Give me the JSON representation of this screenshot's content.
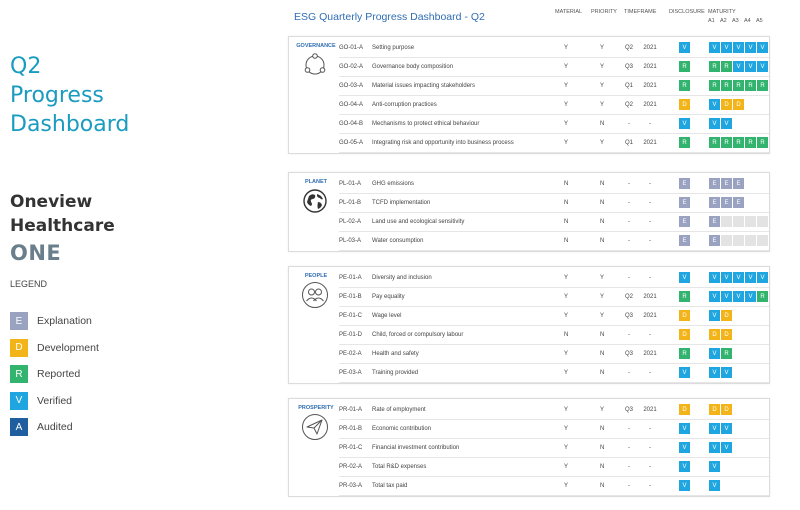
{
  "left": {
    "title_lines": [
      "Q2",
      "Progress",
      "Dashboard"
    ],
    "company_lines": [
      "Oneview",
      "Healthcare"
    ],
    "ticker": "ONE",
    "legend_title": "LEGEND",
    "legend": [
      {
        "letter": "E",
        "label": "Explanation",
        "color": "#9aa2c2"
      },
      {
        "letter": "D",
        "label": "Development",
        "color": "#f2b418"
      },
      {
        "letter": "R",
        "label": "Reported",
        "color": "#33b46e"
      },
      {
        "letter": "V",
        "label": "Verified",
        "color": "#1fa6e0"
      },
      {
        "letter": "A",
        "label": "Audited",
        "color": "#1f5f9f"
      }
    ]
  },
  "dashboard": {
    "title": "ESG Quarterly Progress Dashboard - Q2",
    "headers": {
      "material": "MATERIAL",
      "priority": "PRIORITY",
      "timeframe": "TIMEFRAME",
      "disclosure": "DISCLOSURE",
      "maturity": "MATURITY",
      "maturity_levels": [
        "A1",
        "A2",
        "A3",
        "A4",
        "A5"
      ]
    },
    "sections": [
      {
        "label": "GOVERNANCE",
        "icon": "governance-network-icon",
        "rows": [
          {
            "code": "GO-01-A",
            "name": "Setting purpose",
            "material": "Y",
            "priority": "Y",
            "tf1": "Q2",
            "tf2": "2021",
            "disclosure": "V",
            "maturity": [
              "V",
              "V",
              "V",
              "V",
              "V"
            ]
          },
          {
            "code": "GO-02-A",
            "name": "Governance body composition",
            "material": "Y",
            "priority": "Y",
            "tf1": "Q3",
            "tf2": "2021",
            "disclosure": "R",
            "maturity": [
              "R",
              "R",
              "V",
              "V",
              "V"
            ]
          },
          {
            "code": "GO-03-A",
            "name": "Material issues impacting stakeholders",
            "material": "Y",
            "priority": "Y",
            "tf1": "Q1",
            "tf2": "2021",
            "disclosure": "R",
            "maturity": [
              "R",
              "R",
              "R",
              "R",
              "R"
            ]
          },
          {
            "code": "GO-04-A",
            "name": "Anti-corruption practices",
            "material": "Y",
            "priority": "Y",
            "tf1": "Q2",
            "tf2": "2021",
            "disclosure": "D",
            "maturity": [
              "V",
              "D",
              "D"
            ]
          },
          {
            "code": "GO-04-B",
            "name": "Mechanisms to protect ethical behaviour",
            "material": "Y",
            "priority": "N",
            "tf1": "-",
            "tf2": "-",
            "disclosure": "V",
            "maturity": [
              "V",
              "V"
            ]
          },
          {
            "code": "GO-05-A",
            "name": "Integrating risk and opportunity into business process",
            "material": "Y",
            "priority": "Y",
            "tf1": "Q1",
            "tf2": "2021",
            "disclosure": "R",
            "maturity": [
              "R",
              "R",
              "R",
              "R",
              "R"
            ]
          }
        ]
      },
      {
        "label": "PLANET",
        "icon": "globe-icon",
        "rows": [
          {
            "code": "PL-01-A",
            "name": "GHG emissions",
            "material": "N",
            "priority": "N",
            "tf1": "-",
            "tf2": "-",
            "disclosure": "E",
            "maturity": [
              "E",
              "E",
              "E"
            ]
          },
          {
            "code": "PL-01-B",
            "name": "TCFD implementation",
            "material": "N",
            "priority": "N",
            "tf1": "-",
            "tf2": "-",
            "disclosure": "E",
            "maturity": [
              "E",
              "E",
              "E"
            ]
          },
          {
            "code": "PL-02-A",
            "name": "Land use and ecological sensitivity",
            "material": "N",
            "priority": "N",
            "tf1": "-",
            "tf2": "-",
            "disclosure": "E",
            "maturity": [
              "E",
              "X",
              "X",
              "X",
              "X"
            ]
          },
          {
            "code": "PL-03-A",
            "name": "Water consumption",
            "material": "N",
            "priority": "N",
            "tf1": "-",
            "tf2": "-",
            "disclosure": "E",
            "maturity": [
              "E",
              "X",
              "X",
              "X",
              "X"
            ]
          }
        ]
      },
      {
        "label": "PEOPLE",
        "icon": "people-icon",
        "rows": [
          {
            "code": "PE-01-A",
            "name": "Diversity and inclusion",
            "material": "Y",
            "priority": "Y",
            "tf1": "-",
            "tf2": "-",
            "disclosure": "V",
            "maturity": [
              "V",
              "V",
              "V",
              "V",
              "V"
            ]
          },
          {
            "code": "PE-01-B",
            "name": "Pay equality",
            "material": "Y",
            "priority": "Y",
            "tf1": "Q2",
            "tf2": "2021",
            "disclosure": "R",
            "maturity": [
              "V",
              "V",
              "V",
              "V",
              "R"
            ]
          },
          {
            "code": "PE-01-C",
            "name": "Wage level",
            "material": "Y",
            "priority": "Y",
            "tf1": "Q3",
            "tf2": "2021",
            "disclosure": "D",
            "maturity": [
              "V",
              "D"
            ]
          },
          {
            "code": "PE-01-D",
            "name": "Child, forced or compulsory labour",
            "material": "N",
            "priority": "N",
            "tf1": "-",
            "tf2": "-",
            "disclosure": "D",
            "maturity": [
              "D",
              "D"
            ]
          },
          {
            "code": "PE-02-A",
            "name": "Health and safety",
            "material": "Y",
            "priority": "N",
            "tf1": "Q3",
            "tf2": "2021",
            "disclosure": "R",
            "maturity": [
              "V",
              "R"
            ]
          },
          {
            "code": "PE-03-A",
            "name": "Training provided",
            "material": "Y",
            "priority": "N",
            "tf1": "-",
            "tf2": "-",
            "disclosure": "V",
            "maturity": [
              "V",
              "V"
            ]
          }
        ]
      },
      {
        "label": "PROSPERITY",
        "icon": "paper-plane-icon",
        "rows": [
          {
            "code": "PR-01-A",
            "name": "Rate of employment",
            "material": "Y",
            "priority": "Y",
            "tf1": "Q3",
            "tf2": "2021",
            "disclosure": "D",
            "maturity": [
              "D",
              "D"
            ]
          },
          {
            "code": "PR-01-B",
            "name": "Economic contribution",
            "material": "Y",
            "priority": "N",
            "tf1": "-",
            "tf2": "-",
            "disclosure": "V",
            "maturity": [
              "V",
              "V"
            ]
          },
          {
            "code": "PR-01-C",
            "name": "Financial investment contribution",
            "material": "Y",
            "priority": "N",
            "tf1": "-",
            "tf2": "-",
            "disclosure": "V",
            "maturity": [
              "V",
              "V"
            ]
          },
          {
            "code": "PR-02-A",
            "name": "Total R&D expenses",
            "material": "Y",
            "priority": "N",
            "tf1": "-",
            "tf2": "-",
            "disclosure": "V",
            "maturity": [
              "V"
            ]
          },
          {
            "code": "PR-03-A",
            "name": "Total tax paid",
            "material": "Y",
            "priority": "N",
            "tf1": "-",
            "tf2": "-",
            "disclosure": "V",
            "maturity": [
              "V"
            ]
          }
        ]
      }
    ]
  }
}
